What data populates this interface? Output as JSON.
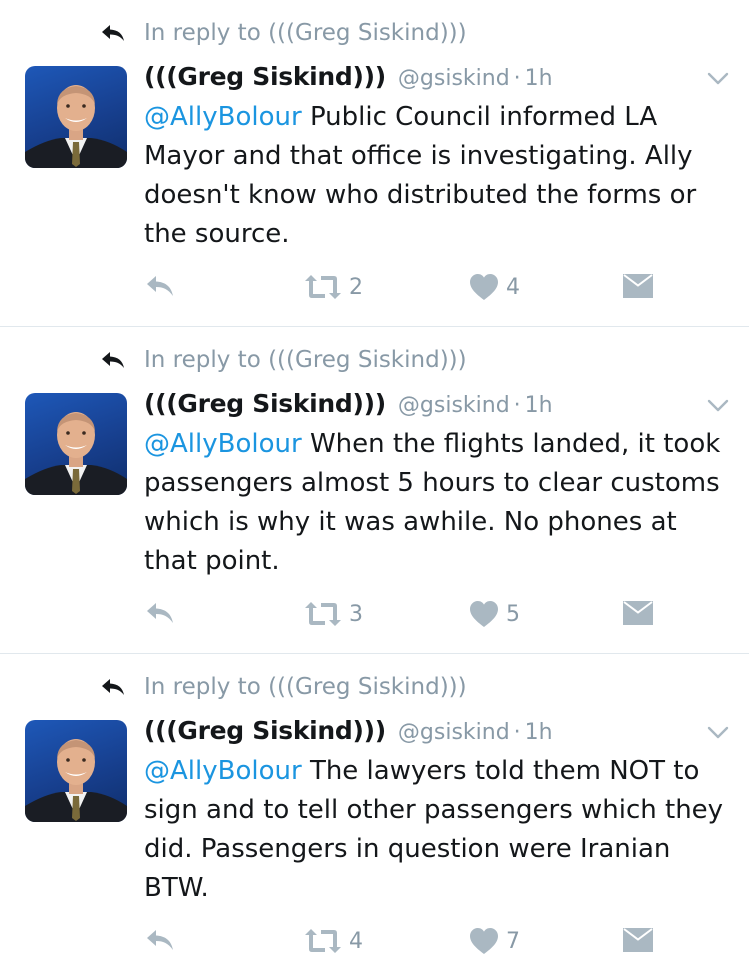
{
  "colors": {
    "link": "#1b95e0",
    "muted": "#8899a6",
    "text": "#14171a",
    "divider": "#e1e8ed"
  },
  "tweets": [
    {
      "reply_context": "In reply to (((Greg Siskind)))",
      "name": "(((Greg Siskind)))",
      "handle": "@gsiskind",
      "separator": "·",
      "time": "1h",
      "mention": "@AllyBolour",
      "text": "Public Council informed LA Mayor and that office is investigating. Ally doesn't know who distributed the forms or the source.",
      "retweets": "2",
      "likes": "4"
    },
    {
      "reply_context": "In reply to (((Greg Siskind)))",
      "name": "(((Greg Siskind)))",
      "handle": "@gsiskind",
      "separator": "·",
      "time": "1h",
      "mention": "@AllyBolour",
      "text": "When the flights landed, it took passengers almost 5 hours to clear customs which is why it was awhile. No phones at that point.",
      "retweets": "3",
      "likes": "5"
    },
    {
      "reply_context": "In reply to (((Greg Siskind)))",
      "name": "(((Greg Siskind)))",
      "handle": "@gsiskind",
      "separator": "·",
      "time": "1h",
      "mention": "@AllyBolour",
      "text": "The lawyers told them NOT to sign and to tell other passengers which they did. Passengers in question were Iranian BTW.",
      "retweets": "4",
      "likes": "7"
    }
  ]
}
